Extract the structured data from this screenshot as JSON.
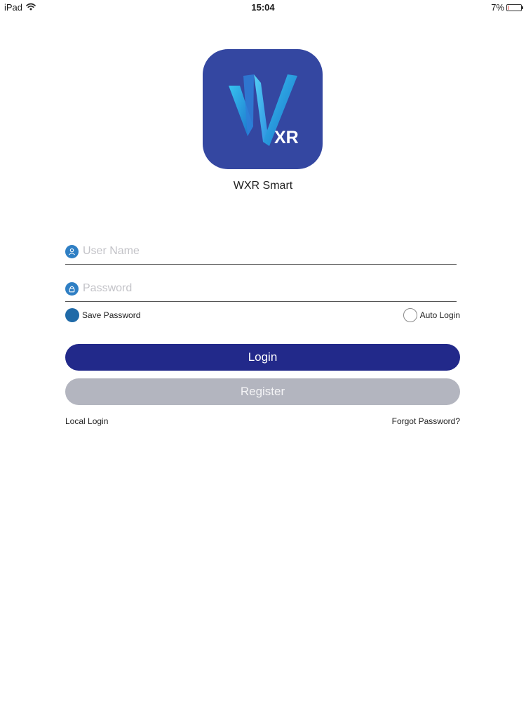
{
  "status_bar": {
    "device": "iPad",
    "time": "15:04",
    "battery_percent_label": "7%",
    "battery_level": 0.07,
    "battery_color": "#e0302c"
  },
  "app": {
    "name": "WXR Smart",
    "logo_text": "XR",
    "icon_bg_color": "#3447a1"
  },
  "form": {
    "username": {
      "value": "",
      "placeholder": "User Name",
      "icon": "user-icon"
    },
    "password": {
      "value": "",
      "placeholder": "Password",
      "icon": "lock-icon"
    },
    "save_password": {
      "label": "Save Password",
      "checked": true
    },
    "auto_login": {
      "label": "Auto Login",
      "checked": false
    },
    "login_button": {
      "label": "Login",
      "color": "#22298a"
    },
    "register_button": {
      "label": "Register",
      "color": "#b3b5bf"
    },
    "local_login_link": "Local Login",
    "forgot_password_link": "Forgot Password?"
  }
}
